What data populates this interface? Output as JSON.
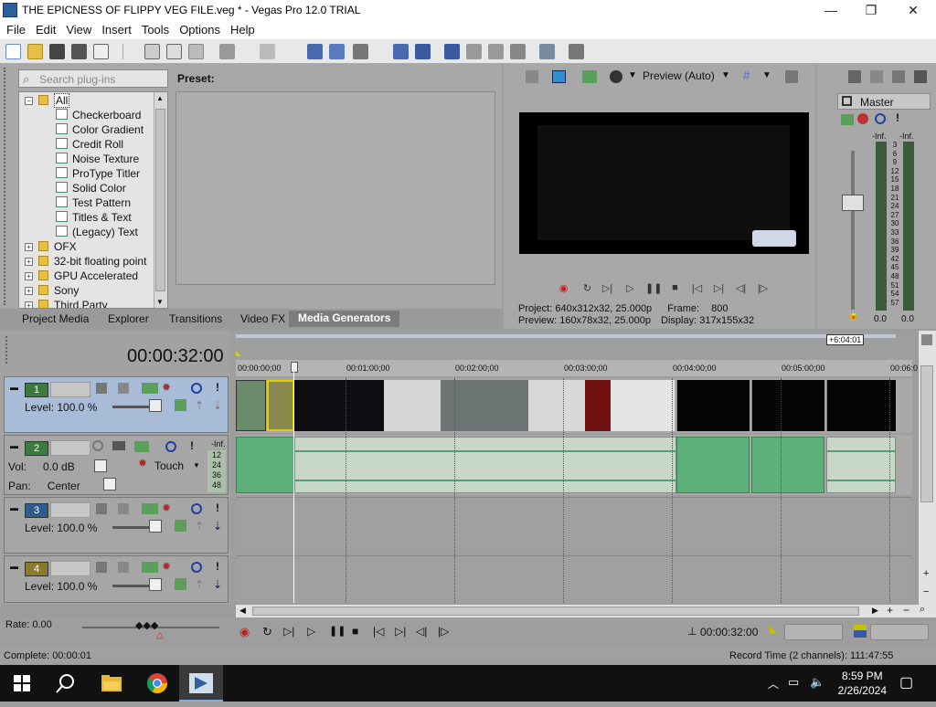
{
  "window": {
    "title": "THE EPICNESS OF FLIPPY VEG FILE.veg * - Vegas Pro 12.0 TRIAL",
    "minimize": "—",
    "maximize": "❐",
    "close": "✕"
  },
  "menu": [
    "File",
    "Edit",
    "View",
    "Insert",
    "Tools",
    "Options",
    "Help"
  ],
  "plugins": {
    "search_placeholder": "Search plug-ins",
    "root": "All",
    "generators": [
      "Checkerboard",
      "Color Gradient",
      "Credit Roll",
      "Noise Texture",
      "ProType Titler",
      "Solid Color",
      "Test Pattern",
      "Titles & Text",
      "(Legacy) Text"
    ],
    "folders": [
      "OFX",
      "32-bit floating point",
      "GPU Accelerated",
      "Sony",
      "Third Party"
    ],
    "preset_label": "Preset:"
  },
  "tabs": [
    "Project Media",
    "Explorer",
    "Transitions",
    "Video FX",
    "Media Generators"
  ],
  "active_tab": "Media Generators",
  "preview": {
    "mode": "Preview (Auto)",
    "project_label": "Project:",
    "project_value": "640x312x32, 25.000p",
    "frame_label": "Frame:",
    "frame_value": "800",
    "preview_label": "Preview:",
    "preview_value": "160x78x32, 25.000p",
    "display_label": "Display:",
    "display_value": "317x155x32"
  },
  "master": {
    "label": "Master",
    "inf_left": "-Inf.",
    "inf_right": "-Inf.",
    "scale": [
      "3",
      "6",
      "9",
      "12",
      "15",
      "18",
      "21",
      "24",
      "27",
      "30",
      "33",
      "36",
      "39",
      "42",
      "45",
      "48",
      "51",
      "54",
      "57"
    ],
    "val_left": "0.0",
    "val_right": "0.0"
  },
  "timeline": {
    "timecode": "00:00:32:00",
    "end_marker": "+6:04:01",
    "ruler": [
      "00:00:00;00",
      "00:01:00;00",
      "00:02:00;00",
      "00:03:00;00",
      "00:04:00;00",
      "00:05:00;00",
      "00:06:0"
    ]
  },
  "tracks": [
    {
      "num": "1",
      "type": "video",
      "level_label": "Level:",
      "level": "100.0 %"
    },
    {
      "num": "2",
      "type": "audio",
      "vol_label": "Vol:",
      "vol": "0.0 dB",
      "pan_label": "Pan:",
      "pan": "Center",
      "mode": "Touch",
      "meter_top": "-Inf.",
      "meter_ticks": [
        "12",
        "24",
        "36",
        "48"
      ]
    },
    {
      "num": "3",
      "type": "video",
      "level_label": "Level:",
      "level": "100.0 %"
    },
    {
      "num": "4",
      "type": "video",
      "level_label": "Level:",
      "level": "100.0 %"
    }
  ],
  "transport": {
    "rate": "Rate: 0.00",
    "cursor_time": "00:00:32:00"
  },
  "status": {
    "complete": "Complete: 00:00:01",
    "record_time": "Record Time (2 channels): 111:47:55"
  },
  "taskbar": {
    "time": "8:59 PM",
    "date": "2/26/2024"
  },
  "colors": {
    "audio_wave": "#4f9f6f",
    "track1": "#3d7a3d",
    "track3": "#2e5d8a",
    "track4": "#8a7a2e"
  }
}
